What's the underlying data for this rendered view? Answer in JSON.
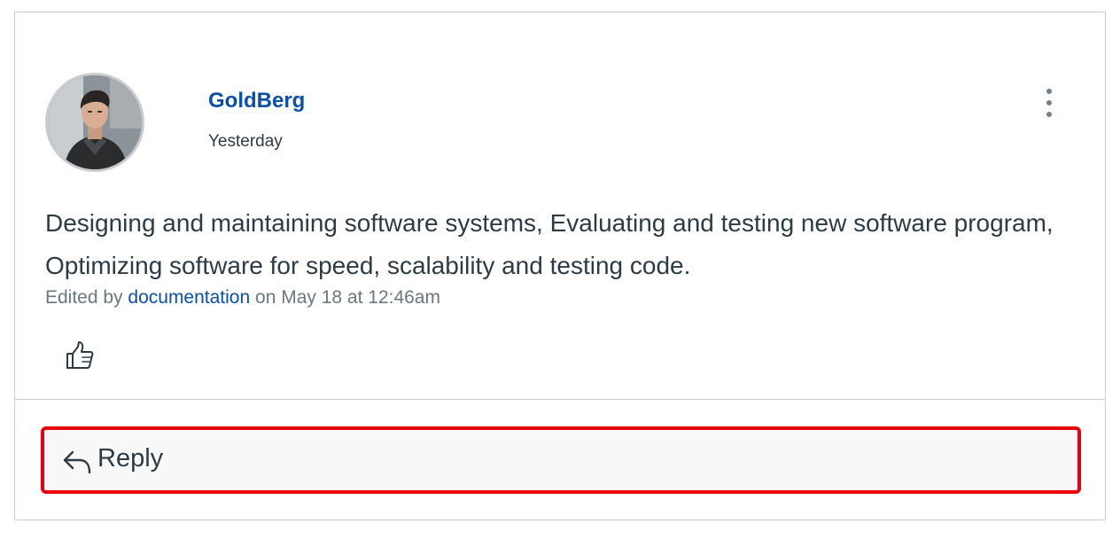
{
  "post": {
    "author": "GoldBerg",
    "timestamp": "Yesterday",
    "body": "Designing and maintaining software systems, Evaluating and testing new software program, Optimizing software for speed, scalability and testing code.",
    "edited": {
      "prefix": "Edited by",
      "editor": "documentation",
      "suffix": "on May 18 at 12:46am"
    },
    "icons": {
      "avatar": "user-photo-avatar",
      "more": "kebab-menu-icon",
      "like": "thumbs-up-icon"
    }
  },
  "reply": {
    "label": "Reply",
    "icon": "reply-arrow-icon",
    "highlight_color": "#e8000f"
  },
  "colors": {
    "link": "#0b4fa8",
    "text": "#2d3b45",
    "muted": "#6b7780",
    "border": "#c7cdd1"
  }
}
